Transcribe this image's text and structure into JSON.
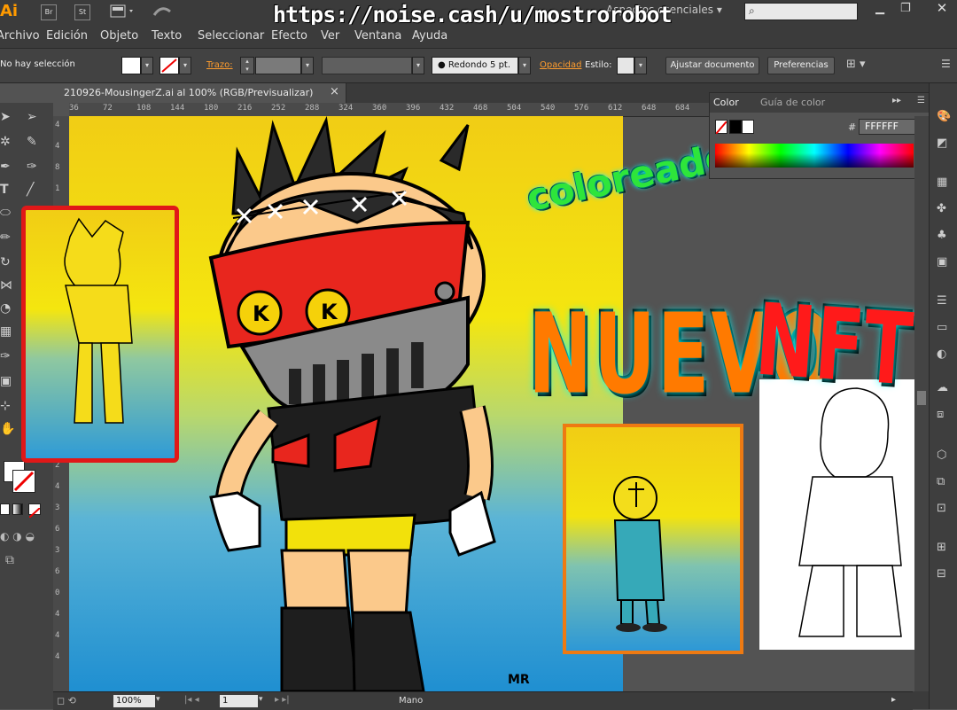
{
  "app": {
    "logo": "Ai",
    "workspace": "Aspectos esenciales",
    "search_placeholder": "",
    "watermark_url": "https://noise.cash/u/mostrorobot",
    "bridge_label": "Br",
    "stock_label": "St"
  },
  "menu": [
    "Archivo",
    "Edición",
    "Objeto",
    "Texto",
    "Seleccionar",
    "Efecto",
    "Ver",
    "Ventana",
    "Ayuda"
  ],
  "control": {
    "selection_status": "No hay selección",
    "stroke_label": "Trazo:",
    "brush": "Redondo 5 pt.",
    "opacity_label": "Opacidad",
    "style_label": "Estilo:",
    "adjust_doc_button": "Ajustar documento",
    "prefs_button": "Preferencias"
  },
  "document": {
    "tab_title": "210926-MousingerZ.ai al 100% (RGB/Previsualizar)",
    "close": "×"
  },
  "ruler_h": [
    "36",
    "72",
    "108",
    "144",
    "180",
    "216",
    "252",
    "288",
    "324",
    "360",
    "396",
    "432",
    "468",
    "504",
    "540",
    "576",
    "612",
    "648",
    "684"
  ],
  "ruler_v": [
    "4",
    "4",
    "8",
    "1",
    "2",
    "6",
    "1",
    "2",
    "6",
    "2",
    "4",
    "2",
    "2",
    "8",
    "8",
    "3",
    "2",
    "4",
    "3",
    "6",
    "3",
    "6",
    "0",
    "4",
    "4",
    "4",
    "3",
    "2"
  ],
  "color_panel": {
    "tab_color": "Color",
    "tab_guide": "Guía de color",
    "hex_prefix": "#",
    "hex_value": "FFFFFF"
  },
  "status": {
    "zoom": "100%",
    "page": "1",
    "tool": "Mano"
  },
  "overlay": {
    "line1": "coloreado + avance",
    "line2": "NUEVO",
    "line3": "NFT",
    "visor_letter": "K",
    "signature": "MR"
  },
  "colors": {
    "accent_green": "#2ee53b",
    "accent_orange": "#ff7a00",
    "accent_red": "#ff1a1a",
    "mask_red": "#e8261e",
    "frame_red": "#e01818",
    "frame_orange": "#ee7a12"
  }
}
